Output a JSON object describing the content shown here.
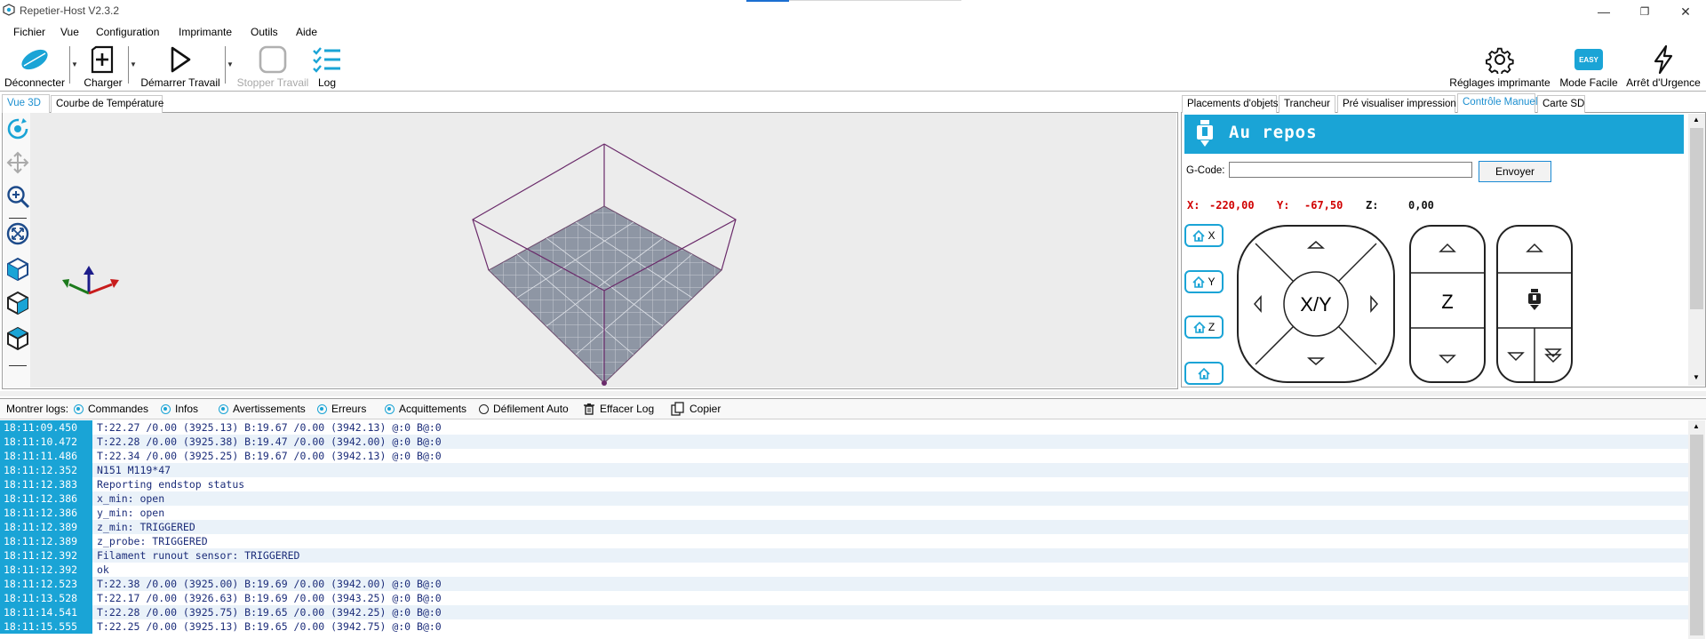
{
  "window": {
    "title": "Repetier-Host V2.3.2",
    "controls": [
      "—",
      "❐",
      "✕"
    ]
  },
  "menu": [
    "Fichier",
    "Vue",
    "Configuration",
    "Imprimante",
    "Outils",
    "Aide"
  ],
  "toolbar": {
    "disconnect": "Déconnecter",
    "load": "Charger",
    "start_job": "Démarrer Travail",
    "stop_job": "Stopper Travail",
    "log": "Log",
    "printer_settings": "Réglages imprimante",
    "easy_mode": "Mode Facile",
    "easy_badge": "EASY",
    "emergency_stop": "Arrêt d'Urgence"
  },
  "left_tabs": [
    "Vue 3D",
    "Courbe de Température"
  ],
  "right_tabs": [
    "Placements d'objets",
    "Trancheur",
    "Pré visualiser impression",
    "Contrôle Manuel",
    "Carte SD"
  ],
  "manual_control": {
    "status": "Au repos",
    "gcode_label": "G-Code:",
    "gcode_value": "",
    "send_label": "Envoyer",
    "x_label": "X:",
    "x_value": "-220,00",
    "y_label": "Y:",
    "y_value": "-67,50",
    "z_label": "Z:",
    "z_value": "0,00",
    "home_x": "X",
    "home_y": "Y",
    "home_z": "Z",
    "xy_label": "X/Y",
    "z_pad_label": "Z"
  },
  "log_toolbar": {
    "show_logs": "Montrer logs:",
    "commands": "Commandes",
    "infos": "Infos",
    "warnings": "Avertissements",
    "errors": "Erreurs",
    "acks": "Acquittements",
    "autoscroll": "Défilement Auto",
    "clear": "Effacer Log",
    "copy": "Copier"
  },
  "log": [
    {
      "time": "18:11:09.450",
      "msg": "T:22.27 /0.00 (3925.13) B:19.67 /0.00 (3942.13) @:0 B@:0"
    },
    {
      "time": "18:11:10.472",
      "msg": "T:22.28 /0.00 (3925.38) B:19.47 /0.00 (3942.00) @:0 B@:0"
    },
    {
      "time": "18:11:11.486",
      "msg": "T:22.34 /0.00 (3925.25) B:19.67 /0.00 (3942.13) @:0 B@:0"
    },
    {
      "time": "18:11:12.352",
      "msg": "N151 M119*47"
    },
    {
      "time": "18:11:12.383",
      "msg": "Reporting endstop status"
    },
    {
      "time": "18:11:12.386",
      "msg": "x_min: open"
    },
    {
      "time": "18:11:12.386",
      "msg": "y_min: open"
    },
    {
      "time": "18:11:12.389",
      "msg": "z_min: TRIGGERED"
    },
    {
      "time": "18:11:12.389",
      "msg": "z_probe: TRIGGERED"
    },
    {
      "time": "18:11:12.392",
      "msg": "Filament runout sensor: TRIGGERED"
    },
    {
      "time": "18:11:12.392",
      "msg": "ok"
    },
    {
      "time": "18:11:12.523",
      "msg": "T:22.38 /0.00 (3925.00) B:19.69 /0.00 (3942.00) @:0 B@:0"
    },
    {
      "time": "18:11:13.528",
      "msg": "T:22.17 /0.00 (3926.63) B:19.69 /0.00 (3943.25) @:0 B@:0"
    },
    {
      "time": "18:11:14.541",
      "msg": "T:22.28 /0.00 (3925.75) B:19.65 /0.00 (3942.25) @:0 B@:0"
    },
    {
      "time": "18:11:15.555",
      "msg": "T:22.25 /0.00 (3925.13) B:19.65 /0.00 (3942.75) @:0 B@:0"
    }
  ],
  "colors": {
    "accent": "#1aa4d6",
    "coord_red": "#d00000"
  }
}
